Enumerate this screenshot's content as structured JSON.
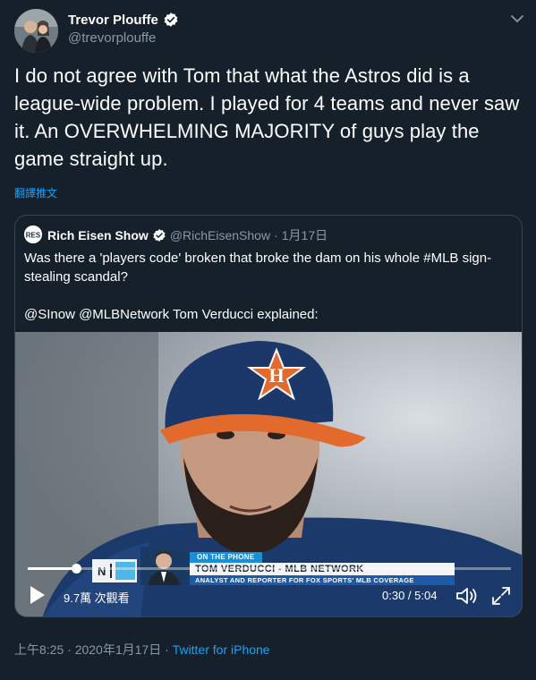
{
  "author": {
    "display_name": "Trevor Plouffe",
    "handle": "@trevorplouffe"
  },
  "tweet": {
    "text": "I do not agree with Tom that what the Astros did is a league-wide problem. I played for 4 teams and never saw it. An OVERWHELMING MAJORITY of guys play the game straight up.",
    "translate_label": "翻譯推文"
  },
  "quoted": {
    "display_name": "Rich Eisen Show",
    "handle": "@RichEisenShow",
    "separator": "·",
    "date": "1月17日",
    "text_line1": "Was there a 'players code' broken that broke the dam on his whole #MLB sign-stealing scandal?",
    "text_line2": "@SInow @MLBNetwork Tom Verducci explained:"
  },
  "video": {
    "lower_third_tag": "ON THE PHONE",
    "lower_third_name": "TOM VERDUCCI - MLB NETWORK",
    "lower_third_sub": "ANALYST AND REPORTER FOR FOX SPORTS' MLB COVERAGE",
    "views": "9.7萬 次觀看",
    "time": "0:30 / 5:04",
    "progress": 0.1
  },
  "footer": {
    "time": "上午8:25 · 2020年1月17日",
    "separator": " · ",
    "source": "Twitter for iPhone"
  },
  "colors": {
    "background": "#15202b",
    "secondary_text": "#8899a6",
    "link": "#1da1f2",
    "border": "#38444d"
  }
}
